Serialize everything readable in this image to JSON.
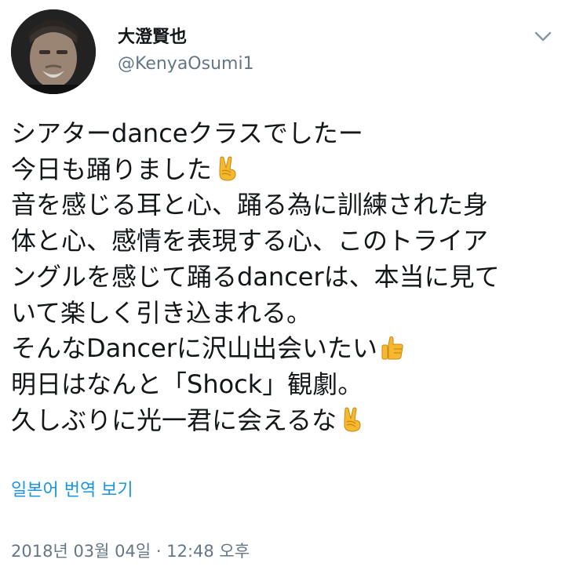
{
  "user": {
    "display_name": "大澄賢也",
    "handle": "@KenyaOsumi1"
  },
  "tweet": {
    "lines": [
      {
        "text": "シアターdanceクラスでしたー",
        "emoji": null
      },
      {
        "text": "今日も踊りました",
        "emoji": "victory-hand"
      },
      {
        "text": "音を感じる耳と心、踊る為に訓練された身",
        "emoji": null
      },
      {
        "text": "体と心、感情を表現する心、このトライア",
        "emoji": null
      },
      {
        "text": "ングルを感じて踊るdancerは、本当に見て",
        "emoji": null
      },
      {
        "text": "いて楽しく引き込まれる。",
        "emoji": null
      },
      {
        "text": "そんなDancerに沢山出会いたい",
        "emoji": "thumbs-up"
      },
      {
        "text": "明日はなんと「Shock」観劇。",
        "emoji": null
      },
      {
        "text": "久しぶりに光一君に会えるな",
        "emoji": "victory-hand"
      }
    ]
  },
  "translate_label": "일본어 번역 보기",
  "timestamp": "2018년 03월 04일 · 12:48 오후",
  "icons": {
    "menu": "chevron-down-icon",
    "victory": "victory-hand-emoji",
    "thumbs": "thumbs-up-emoji"
  },
  "colors": {
    "text": "#14171a",
    "secondary": "#657786",
    "link": "#1b95e0",
    "emoji_skin": "#f5b82e"
  }
}
